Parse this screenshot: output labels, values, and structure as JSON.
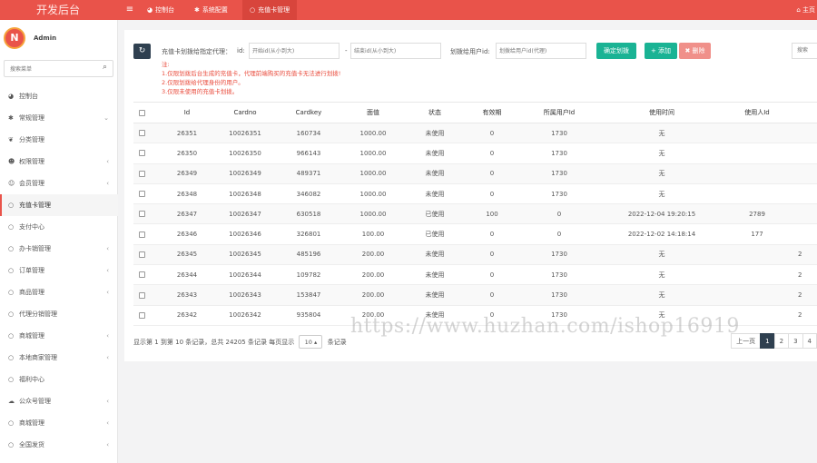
{
  "brand": "开发后台",
  "topbar": {
    "menu_icon": "≡",
    "tabs": [
      {
        "label": "控制台",
        "icon": "dashboard-icon",
        "glyph": "◕"
      },
      {
        "label": "系统配置",
        "icon": "gear-icon",
        "glyph": "✱"
      },
      {
        "label": "充值卡管理",
        "icon": "circle-icon",
        "glyph": "○"
      }
    ],
    "home": "主页",
    "home_glyph": "⌂"
  },
  "sidebar": {
    "avatar_text": "N",
    "username": "Admin",
    "search_placeholder": "搜索菜单",
    "search_glyph": "⌕",
    "items": [
      {
        "label": "控制台",
        "icon": "dashboard-icon",
        "glyph": "◕",
        "chevron": ""
      },
      {
        "label": "常规管理",
        "icon": "cogs-icon",
        "glyph": "✱",
        "chevron": "⌄"
      },
      {
        "label": "分类管理",
        "icon": "leaf-icon",
        "glyph": "❦",
        "chevron": ""
      },
      {
        "label": "权限管理",
        "icon": "group-icon",
        "glyph": "☻",
        "chevron": "‹"
      },
      {
        "label": "会员管理",
        "icon": "user-icon",
        "glyph": "☺",
        "chevron": "‹"
      },
      {
        "label": "充值卡管理",
        "icon": "circle-icon",
        "glyph": "○",
        "chevron": ""
      },
      {
        "label": "支付中心",
        "icon": "circle-icon",
        "glyph": "○",
        "chevron": ""
      },
      {
        "label": "办卡销管理",
        "icon": "circle-icon",
        "glyph": "○",
        "chevron": "‹"
      },
      {
        "label": "订单管理",
        "icon": "circle-icon",
        "glyph": "○",
        "chevron": "‹"
      },
      {
        "label": "商品管理",
        "icon": "circle-icon",
        "glyph": "○",
        "chevron": "‹"
      },
      {
        "label": "代理分销管理",
        "icon": "circle-icon",
        "glyph": "○",
        "chevron": ""
      },
      {
        "label": "商城管理",
        "icon": "circle-icon",
        "glyph": "○",
        "chevron": "‹"
      },
      {
        "label": "本地商家管理",
        "icon": "circle-icon",
        "glyph": "○",
        "chevron": "‹"
      },
      {
        "label": "福利中心",
        "icon": "circle-icon",
        "glyph": "○",
        "chevron": ""
      },
      {
        "label": "公众号管理",
        "icon": "wechat-icon",
        "glyph": "☁",
        "chevron": "‹"
      },
      {
        "label": "商城管理",
        "icon": "circle-icon",
        "glyph": "○",
        "chevron": "‹"
      },
      {
        "label": "全国发货",
        "icon": "circle-icon",
        "glyph": "○",
        "chevron": "‹"
      }
    ],
    "active_index": 5
  },
  "toolbar": {
    "refresh_glyph": "↻",
    "assign_label": "充值卡划拨给指定代理：",
    "id_label": "id:",
    "start_placeholder": "开始id(从小到大)",
    "dash": "-",
    "end_placeholder": "结束id(从小到大)",
    "user_label": "划拨给用户id:",
    "user_placeholder": "划拨给用户id(代理)",
    "confirm_label": "确定划拨",
    "add_label": "+ 添加",
    "delete_label": "✖ 删除",
    "search_placeholder": "搜索"
  },
  "notes": [
    "注:",
    "1.仅限划拨后台生成的充值卡，代理前端购买的充值卡无法进行划拨!",
    "2.仅限划拨给代理身份的用户。",
    "3.仅限未使用的充值卡划拨。"
  ],
  "table": {
    "columns": [
      "Id",
      "Cardno",
      "Cardkey",
      "面值",
      "状态",
      "有效期",
      "所属用户Id",
      "使用时间",
      "使用人Id"
    ],
    "rows": [
      [
        "26351",
        "10026351",
        "160734",
        "1000.00",
        "未使用",
        "0",
        "1730",
        "无",
        "",
        ""
      ],
      [
        "26350",
        "10026350",
        "966143",
        "1000.00",
        "未使用",
        "0",
        "1730",
        "无",
        "",
        ""
      ],
      [
        "26349",
        "10026349",
        "489371",
        "1000.00",
        "未使用",
        "0",
        "1730",
        "无",
        "",
        ""
      ],
      [
        "26348",
        "10026348",
        "346082",
        "1000.00",
        "未使用",
        "0",
        "1730",
        "无",
        "",
        ""
      ],
      [
        "26347",
        "10026347",
        "630518",
        "1000.00",
        "已使用",
        "100",
        "0",
        "2022-12-04 19:20:15",
        "2789",
        ""
      ],
      [
        "26346",
        "10026346",
        "326801",
        "100.00",
        "已使用",
        "0",
        "0",
        "2022-12-02 14:18:14",
        "177",
        ""
      ],
      [
        "26345",
        "10026345",
        "485196",
        "200.00",
        "未使用",
        "0",
        "1730",
        "无",
        "",
        "2"
      ],
      [
        "26344",
        "10026344",
        "109782",
        "200.00",
        "未使用",
        "0",
        "1730",
        "无",
        "",
        "2"
      ],
      [
        "26343",
        "10026343",
        "153847",
        "200.00",
        "未使用",
        "0",
        "1730",
        "无",
        "",
        "2"
      ],
      [
        "26342",
        "10026342",
        "935804",
        "200.00",
        "未使用",
        "0",
        "1730",
        "无",
        "",
        "2"
      ]
    ]
  },
  "footer": {
    "info": "显示第 1 到第 10 条记录，总共 24205 条记录 每页显示",
    "page_size": "10",
    "page_size_glyph": "▴",
    "suffix": "条记录"
  },
  "pagination": [
    "上一页",
    "1",
    "2",
    "3",
    "4"
  ],
  "pagination_active": "1",
  "watermark": "https://www.huzhan.com/ishop16919",
  "colors": {
    "header": "#e9534a",
    "dark": "#2f4050",
    "success": "#1ab394",
    "danger": "#f0908a",
    "note": "#e94b3c"
  }
}
